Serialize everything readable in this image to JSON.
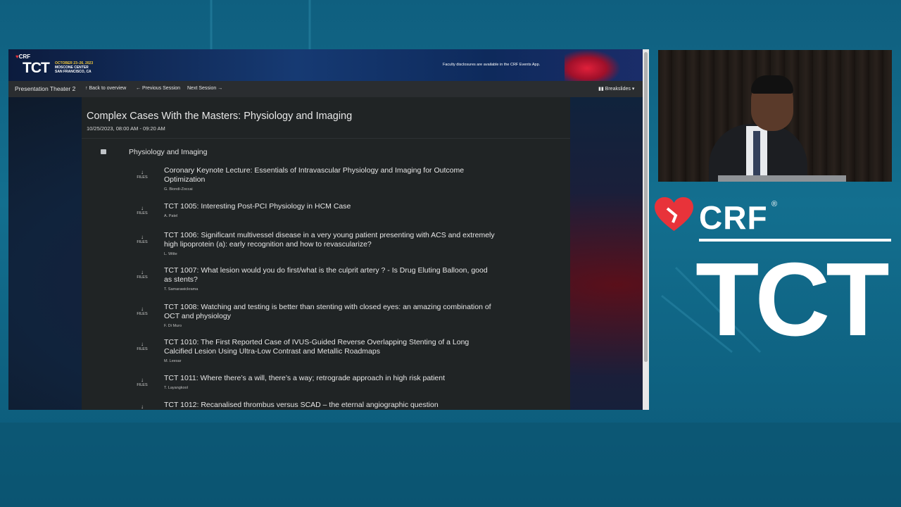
{
  "banner": {
    "crf": "CRF",
    "tct": "TCT",
    "dates": "OCTOBER 23–26, 2023",
    "venue": "MOSCONE CENTER",
    "city": "SAN FRANCISCO, CA",
    "disclosure": "Faculty disclosures are available in the CRF Events App."
  },
  "navbar": {
    "theater": "Presentation Theater 2",
    "back": "Back to overview",
    "previous": "Previous Session",
    "next": "Next Session",
    "breakslides": "Breakslides"
  },
  "session": {
    "title": "Complex Cases With the Masters: Physiology and Imaging",
    "datetime": "10/25/2023, 08:00 AM - 09:20 AM",
    "name": "Physiology and Imaging"
  },
  "files_label": "FILES",
  "talks": [
    {
      "title": "Coronary Keynote Lecture: Essentials of Intravascular Physiology and Imaging for Outcome Optimization",
      "author": "G. Biondi-Zoccai"
    },
    {
      "title": "TCT 1005: Interesting Post-PCI Physiology in HCM Case",
      "author": "A. Patel"
    },
    {
      "title": "TCT 1006: Significant multivessel disease in a very young patient presenting with ACS and extremely high lipoprotein (a): early recognition and how to revascularize?",
      "author": "L. Witte"
    },
    {
      "title": "TCT 1007: What lesion would you do first/what is the culprit artery ? - Is Drug Eluting Balloon, good as stents?",
      "author": "T. Samarawickrama"
    },
    {
      "title": "TCT 1008: Watching and testing is better than stenting with closed eyes: an amazing combination of OCT and physiology",
      "author": "F. Di Muro"
    },
    {
      "title": "TCT 1010: The First Reported Case of IVUS-Guided Reverse Overlapping Stenting of a Long Calcified Lesion Using Ultra-Low Contrast and Metallic Roadmaps",
      "author": "M. Leesar"
    },
    {
      "title": "TCT 1011: Where there’s a will, there’s a way; retrograde approach in high risk patient",
      "author": "T. Layangkool"
    },
    {
      "title": "TCT 1012: Recanalised thrombus versus SCAD – the eternal angiographic question",
      "author": ""
    }
  ],
  "brand": {
    "crf": "CRF",
    "reg": "®",
    "tct": "TCT"
  },
  "colors": {
    "background": "#136f8f",
    "brand_red": "#e8333a",
    "screen_bg": "#171a1c",
    "panel_bg": "#202425",
    "navbar_bg": "#2a2d30"
  }
}
